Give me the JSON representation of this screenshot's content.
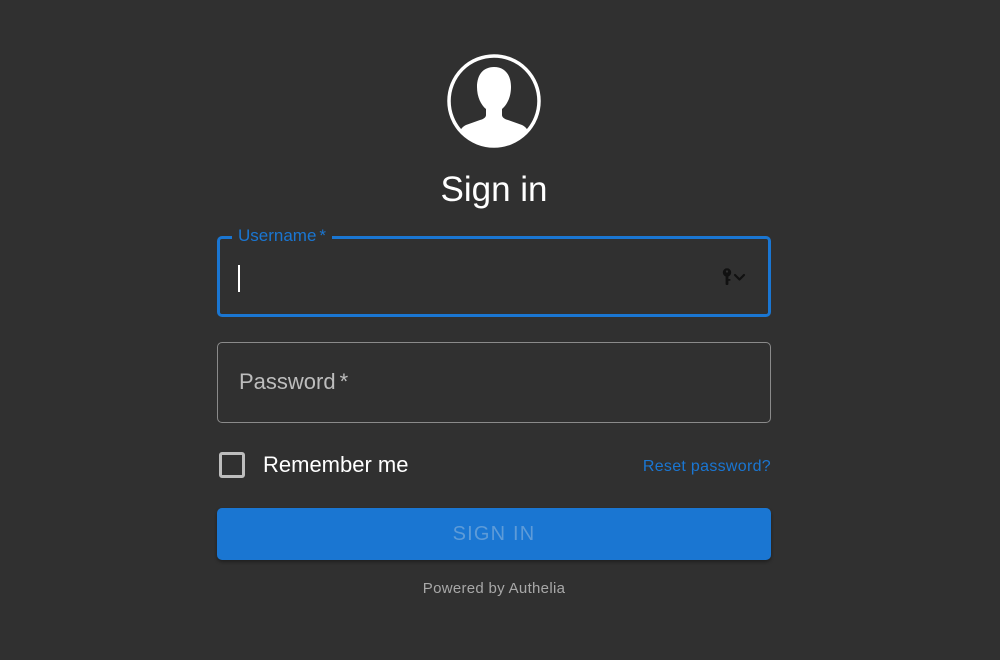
{
  "title": "Sign in",
  "avatar": {
    "icon": "user-avatar-icon"
  },
  "username": {
    "label": "Username",
    "required_mark": "*",
    "value": "",
    "focused": true,
    "adornment_icons": [
      "key-icon",
      "chevron-down-icon"
    ]
  },
  "password": {
    "label": "Password",
    "required_mark": "*",
    "value": ""
  },
  "remember": {
    "label": "Remember me",
    "checked": false
  },
  "reset_link": "Reset password?",
  "signin_button": "SIGN IN",
  "footer": "Powered by Authelia",
  "colors": {
    "background": "#303030",
    "accent": "#1a76d2",
    "text": "#ffffff",
    "muted": "#a8a8a8"
  }
}
